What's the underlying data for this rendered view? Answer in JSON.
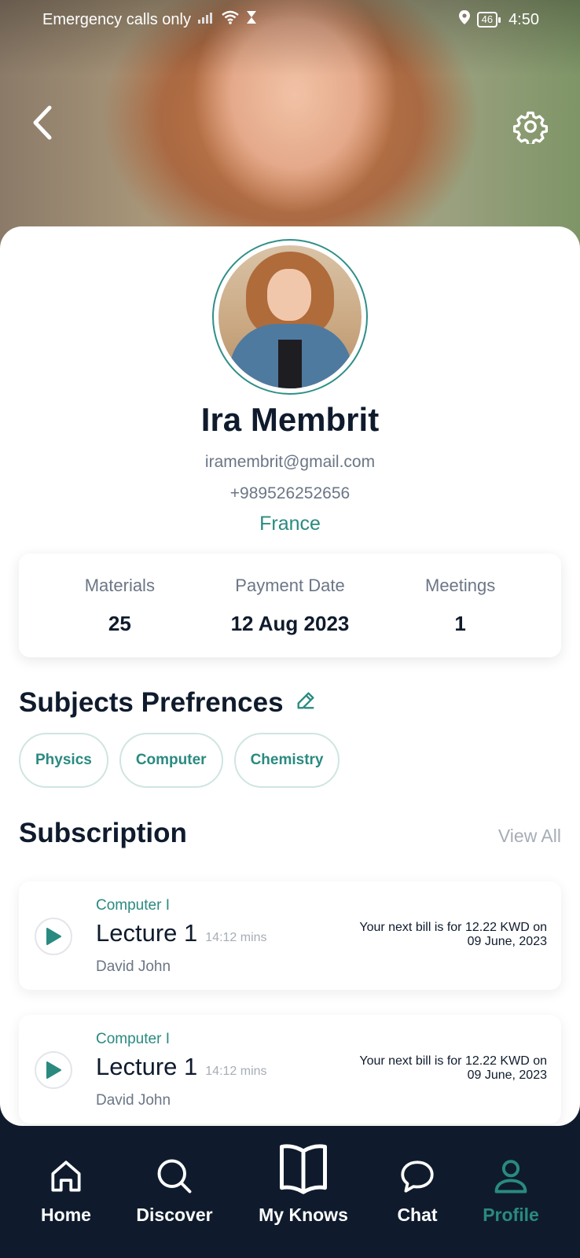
{
  "status_bar": {
    "carrier_text": "Emergency calls only",
    "battery": "46",
    "time": "4:50"
  },
  "profile": {
    "name": "Ira Membrit",
    "email": "iramembrit@gmail.com",
    "phone": "+989526252656",
    "country": "France"
  },
  "stats": {
    "materials_label": "Materials",
    "materials_value": "25",
    "payment_label": "Payment Date",
    "payment_value": "12 Aug 2023",
    "meetings_label": "Meetings",
    "meetings_value": "1"
  },
  "preferences": {
    "title": "Subjects Prefrences",
    "chips": [
      "Physics",
      "Computer",
      "Chemistry"
    ]
  },
  "subscription": {
    "title": "Subscription",
    "view_all": "View All",
    "items": [
      {
        "course": "Computer I",
        "lecture": "Lecture 1",
        "duration": "14:12 mins",
        "teacher": "David John",
        "bill_line1": "Your next bill is for 12.22 KWD on",
        "bill_line2": "09 June, 2023"
      },
      {
        "course": "Computer I",
        "lecture": "Lecture 1",
        "duration": "14:12 mins",
        "teacher": "David John",
        "bill_line1": "Your next bill is for 12.22 KWD on",
        "bill_line2": "09 June, 2023"
      }
    ]
  },
  "nav": {
    "home": "Home",
    "discover": "Discover",
    "my_knows": "My Knows",
    "chat": "Chat",
    "profile": "Profile",
    "active": "profile"
  },
  "colors": {
    "accent": "#2a8a80",
    "dark": "#0f1b2d",
    "muted": "#6b7686"
  }
}
